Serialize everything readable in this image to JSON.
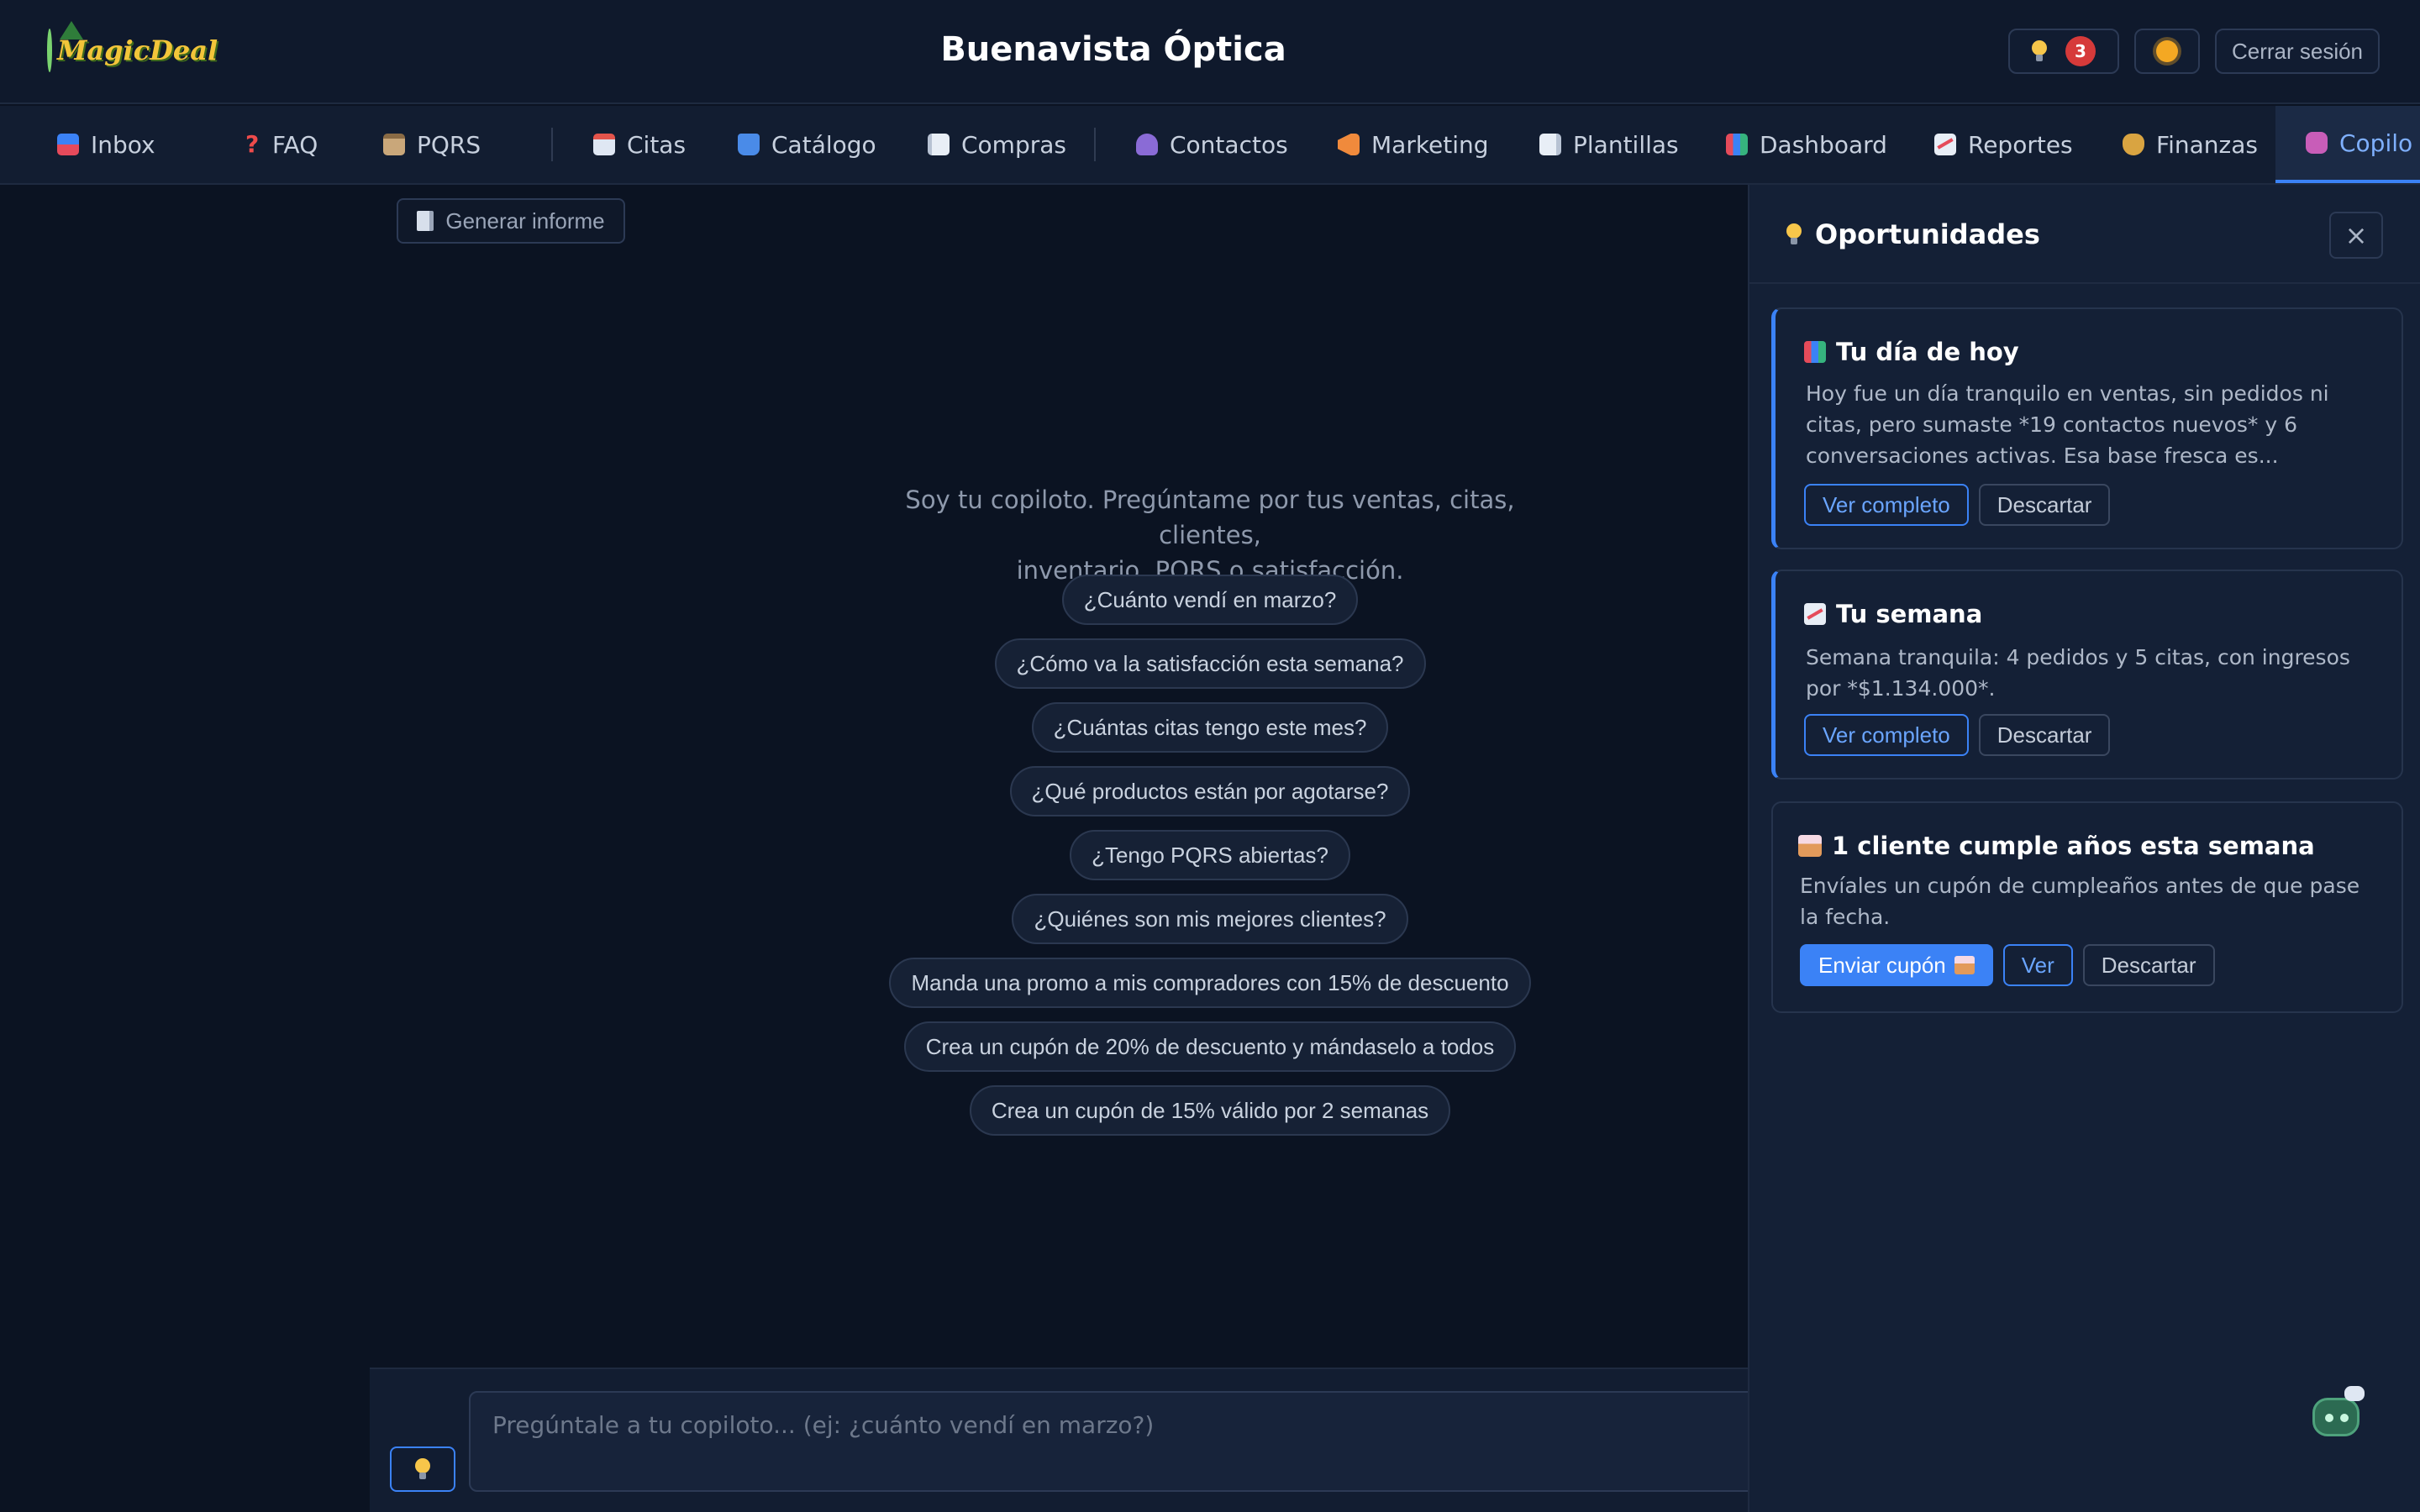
{
  "app": {
    "logo_text": "MagicDeal",
    "title": "Buenavista Óptica",
    "notification_count": "3",
    "logout_label": "Cerrar sesión"
  },
  "nav": {
    "items": [
      {
        "label": "Inbox",
        "icon": "inbox-icon"
      },
      {
        "label": "FAQ",
        "icon": "question-icon"
      },
      {
        "label": "PQRS",
        "icon": "clipboard-icon"
      },
      {
        "label": "Citas",
        "icon": "calendar-icon"
      },
      {
        "label": "Catálogo",
        "icon": "shopping-bags-icon"
      },
      {
        "label": "Compras",
        "icon": "receipt-icon"
      },
      {
        "label": "Contactos",
        "icon": "user-icon"
      },
      {
        "label": "Marketing",
        "icon": "megaphone-icon"
      },
      {
        "label": "Plantillas",
        "icon": "document-icon"
      },
      {
        "label": "Dashboard",
        "icon": "bar-chart-icon"
      },
      {
        "label": "Reportes",
        "icon": "trend-chart-icon"
      },
      {
        "label": "Finanzas",
        "icon": "money-bag-icon"
      },
      {
        "label": "Copilo",
        "icon": "robot-icon"
      }
    ],
    "active": "Copilo"
  },
  "chat": {
    "report_button": "Generar informe",
    "intro_line1": "Soy tu copiloto. Pregúntame por tus ventas, citas, clientes,",
    "intro_line2": "inventario, PQRS o satisfacción.",
    "suggestions": [
      "¿Cuánto vendí en marzo?",
      "¿Cómo va la satisfacción esta semana?",
      "¿Cuántas citas tengo este mes?",
      "¿Qué productos están por agotarse?",
      "¿Tengo PQRS abiertas?",
      "¿Quiénes son mis mejores clientes?",
      "Manda una promo a mis compradores con 15% de descuento",
      "Crea un cupón de 20% de descuento y mándaselo a todos",
      "Crea un cupón de 15% válido por 2 semanas"
    ],
    "input_placeholder": "Pregúntale a tu copiloto... (ej: ¿cuánto vendí en marzo?)"
  },
  "panel": {
    "title": "Oportunidades",
    "close_label": "×",
    "cards": [
      {
        "title": "Tu día de hoy",
        "body": "Hoy fue un día tranquilo en ventas, sin pedidos ni citas, pero sumaste *19 contactos nuevos* y 6 conversaciones activas. Esa base fresca es...",
        "primary": "Ver completo",
        "secondary": "Descartar"
      },
      {
        "title": "Tu semana",
        "body": "Semana tranquila: 4 pedidos y 5 citas, con ingresos por *$1.134.000*.",
        "primary": "Ver completo",
        "secondary": "Descartar"
      },
      {
        "title": "1 cliente cumple años esta semana",
        "body": "Envíales un cupón de cumpleaños antes de que pase la fecha.",
        "cta": "Enviar cupón",
        "primary": "Ver",
        "secondary": "Descartar"
      }
    ]
  },
  "colors": {
    "background": "#0b1322",
    "accent": "#3b82f6",
    "badge": "#d63a3a"
  }
}
